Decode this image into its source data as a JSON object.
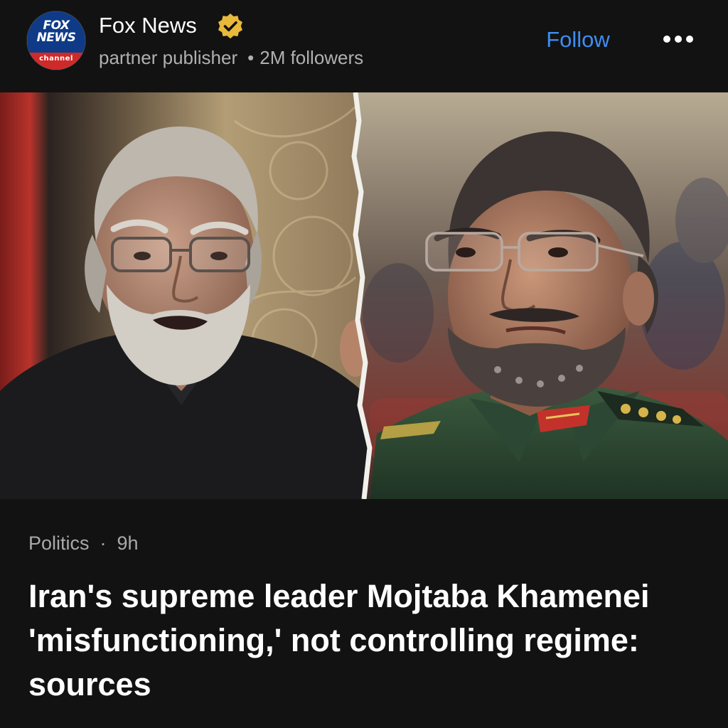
{
  "publisher": {
    "logo_line1": "FOX",
    "logo_line2": "NEWS",
    "logo_sub": "channel",
    "name": "Fox News",
    "verified_icon": "verified-badge-icon",
    "role": "partner publisher",
    "followers": "2M followers",
    "follow_label": "Follow",
    "more_icon": "more-options-icon"
  },
  "hero_image": {
    "subject": "split photo of two men",
    "left_panel": "gray-haired man with beard and glasses, dark suit",
    "right_panel": "man with glasses in green military uniform"
  },
  "article": {
    "category": "Politics",
    "age": "9h",
    "headline": "Iran's supreme leader Mojtaba Khamenei 'misfunctioning,' not controlling regime: sources"
  },
  "colors": {
    "background": "#121212",
    "follow_blue": "#3d8ef2",
    "meta_gray": "#b0b0b0",
    "verified_gold": "#e8b93a"
  }
}
